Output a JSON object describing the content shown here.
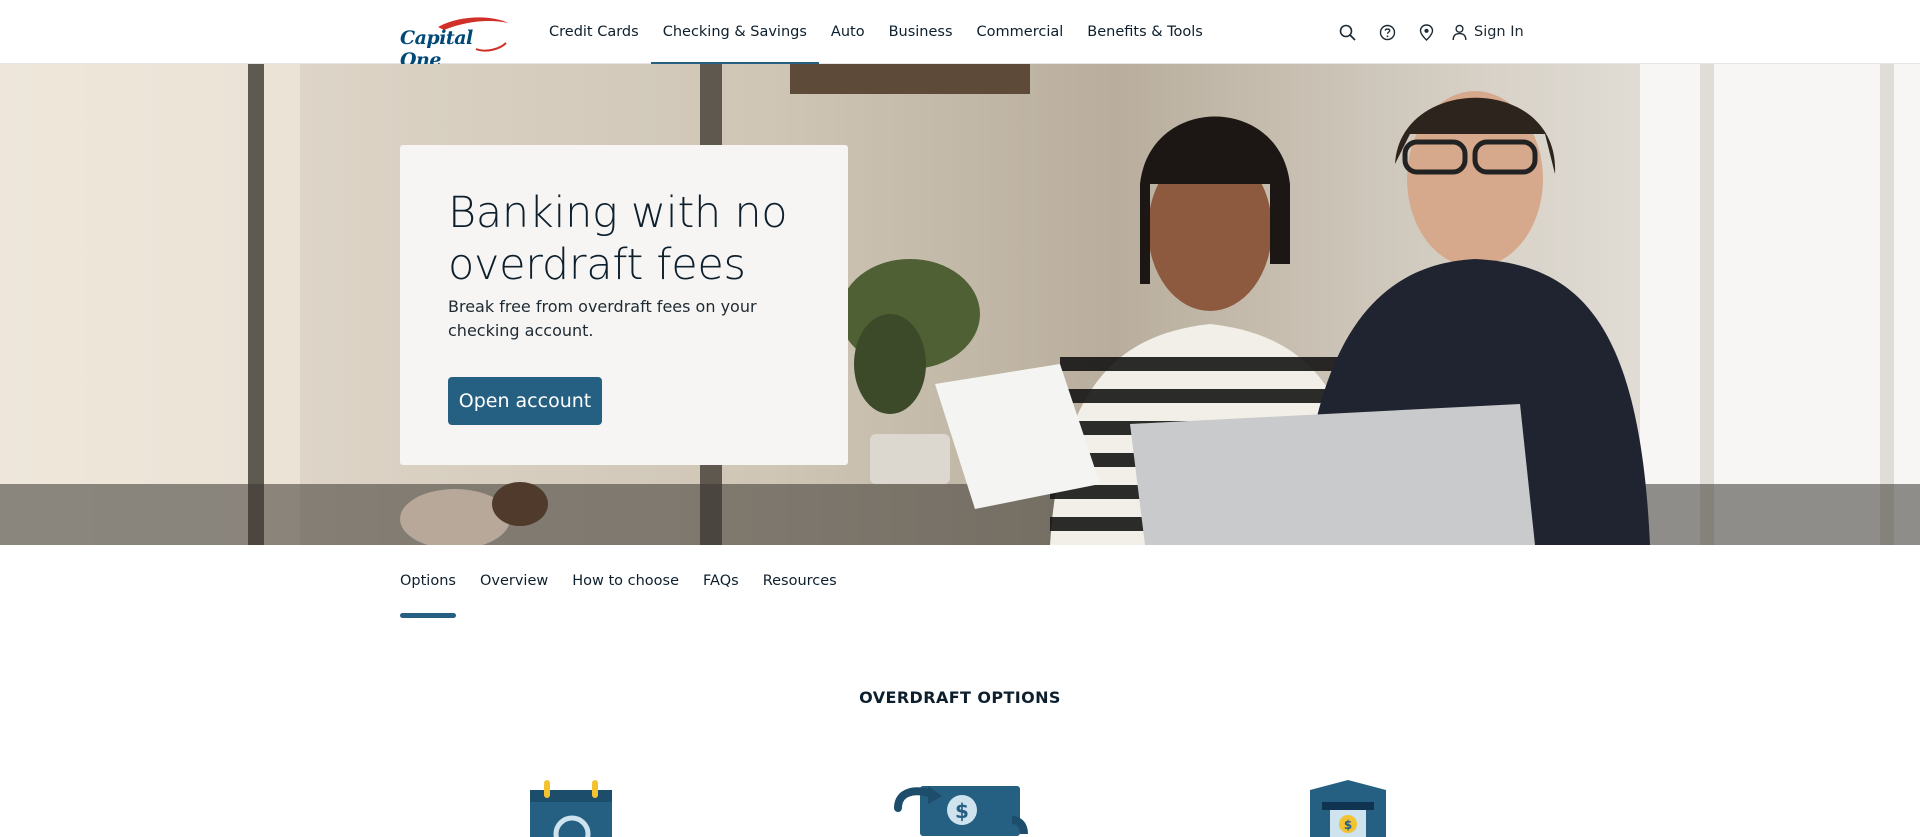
{
  "header": {
    "logo_text": "Capital One",
    "nav": [
      {
        "label": "Credit Cards",
        "active": false
      },
      {
        "label": "Checking & Savings",
        "active": true
      },
      {
        "label": "Auto",
        "active": false
      },
      {
        "label": "Business",
        "active": false
      },
      {
        "label": "Commercial",
        "active": false
      },
      {
        "label": "Benefits & Tools",
        "active": false
      }
    ],
    "utility_icons": [
      "search-icon",
      "help-icon",
      "location-icon",
      "user-icon"
    ],
    "sign_in_label": "Sign In"
  },
  "hero": {
    "title": "Banking with no overdraft fees",
    "subtitle": "Break free from overdraft fees on your checking account.",
    "cta_label": "Open account"
  },
  "subnav": {
    "items": [
      {
        "label": "Options",
        "active": true
      },
      {
        "label": "Overview",
        "active": false
      },
      {
        "label": "How to choose",
        "active": false
      },
      {
        "label": "FAQs",
        "active": false
      },
      {
        "label": "Resources",
        "active": false
      }
    ]
  },
  "section": {
    "title": "OVERDRAFT OPTIONS",
    "icons": [
      "calendar-icon",
      "money-transfer-icon",
      "shield-atm-icon"
    ]
  },
  "colors": {
    "brand_navy": "#004977",
    "brand_red": "#d03027",
    "accent_blue": "#255f82",
    "icon_blue": "#255f82",
    "icon_yellow": "#f2c230"
  }
}
